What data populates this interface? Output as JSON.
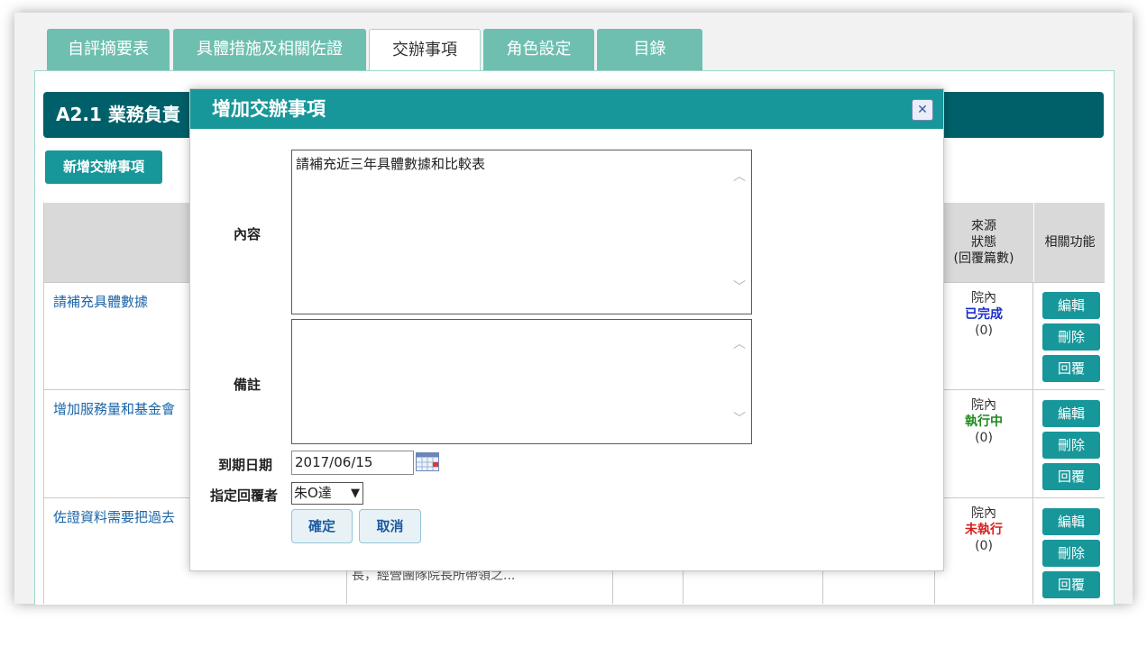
{
  "tabs": [
    {
      "label": "自評摘要表"
    },
    {
      "label": "具體措施及相關佐證"
    },
    {
      "label": "交辦事項"
    },
    {
      "label": "角色設定"
    },
    {
      "label": "目錄"
    }
  ],
  "page_header": {
    "title": "A2.1 業務負責"
  },
  "toolbar": {
    "add_button": "新增交辦事項"
  },
  "table": {
    "headers": {
      "source_status": [
        "來源",
        "狀態",
        "(回覆篇數)"
      ],
      "functions": "相關功能"
    },
    "rows": [
      {
        "title": "請補充具體數據",
        "source": "院內",
        "status": "已完成",
        "replies": "(0)",
        "status_color": "#1a2ec8"
      },
      {
        "title": "增加服務量和基金會",
        "source": "院內",
        "status": "執行中",
        "replies": "(0)",
        "status_color": "#1e8a1e"
      },
      {
        "title": "佐證資料需要把過去",
        "source": "院內",
        "status": "未執行",
        "replies": "(0)",
        "status_color": "#d52020",
        "snippet": "長，經營團隊院長所帶領之..."
      }
    ],
    "row_buttons": {
      "edit": "編輯",
      "delete": "刪除",
      "reply": "回覆"
    }
  },
  "modal": {
    "title": "增加交辦事項",
    "close_icon": "close-icon",
    "content_label": "內容",
    "content_value": "請補充近三年具體數據和比較表",
    "note_label": "備註",
    "note_value": "",
    "due_date_label": "到期日期",
    "due_date_value": "2017/06/15",
    "assignee_label": "指定回覆者",
    "assignee_value": "朱O達",
    "confirm_button": "確定",
    "cancel_button": "取消"
  },
  "colors": {
    "tab": "#6ebfb0",
    "header": "#006069",
    "accent": "#18979a",
    "link": "#1a65a8"
  }
}
